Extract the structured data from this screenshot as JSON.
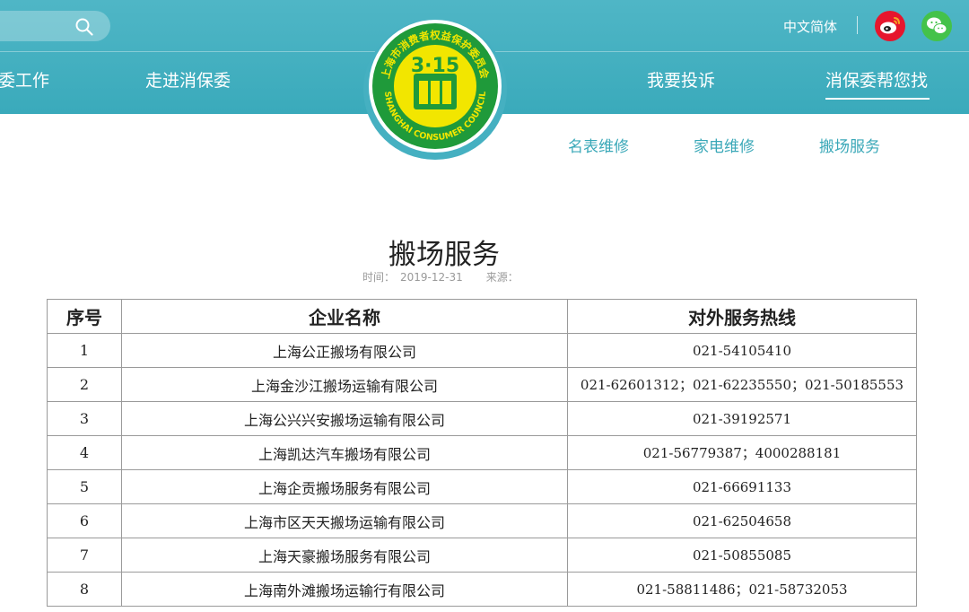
{
  "header": {
    "lang_label": "中文简体",
    "nav": {
      "item1": "委工作",
      "item2": "走进消保委",
      "item3": "我要投诉",
      "item4": "消保委帮您找"
    },
    "logo": {
      "top_text": "上海市消费者权益保护委员会",
      "bottom_text": "SHANGHAI CONSUMER COUNCIL",
      "center": "3·15"
    },
    "colors": {
      "header_bg": "#45b0c1",
      "logo_green": "#1f9a3a",
      "logo_yellow": "#f2e600",
      "weibo_red": "#e6162d",
      "wechat_green": "#44c24a"
    }
  },
  "subnav": {
    "item1": "名表维修",
    "item2": "家电维修",
    "item3": "搬场服务"
  },
  "article": {
    "title": "搬场服务",
    "time_label": "时间：",
    "time_value": "2019-12-31",
    "source_label": "来源："
  },
  "table": {
    "headers": [
      "序号",
      "企业名称",
      "对外服务热线"
    ],
    "rows": [
      {
        "no": "1",
        "name": "上海公正搬场有限公司",
        "phone": "021-54105410"
      },
      {
        "no": "2",
        "name": "上海金沙江搬场运输有限公司",
        "phone": "021-62601312；021-62235550；021-50185553"
      },
      {
        "no": "3",
        "name": "上海公兴兴安搬场运输有限公司",
        "phone": "021-39192571"
      },
      {
        "no": "4",
        "name": "上海凯达汽车搬场有限公司",
        "phone": "021-56779387；4000288181"
      },
      {
        "no": "5",
        "name": "上海企贡搬场服务有限公司",
        "phone": "021-66691133"
      },
      {
        "no": "6",
        "name": "上海市区天天搬场运输有限公司",
        "phone": "021-62504658"
      },
      {
        "no": "7",
        "name": "上海天豪搬场服务有限公司",
        "phone": "021-50855085"
      },
      {
        "no": "8",
        "name": "上海南外滩搬场运输行有限公司",
        "phone": "021-58811486；021-58732053"
      }
    ]
  }
}
